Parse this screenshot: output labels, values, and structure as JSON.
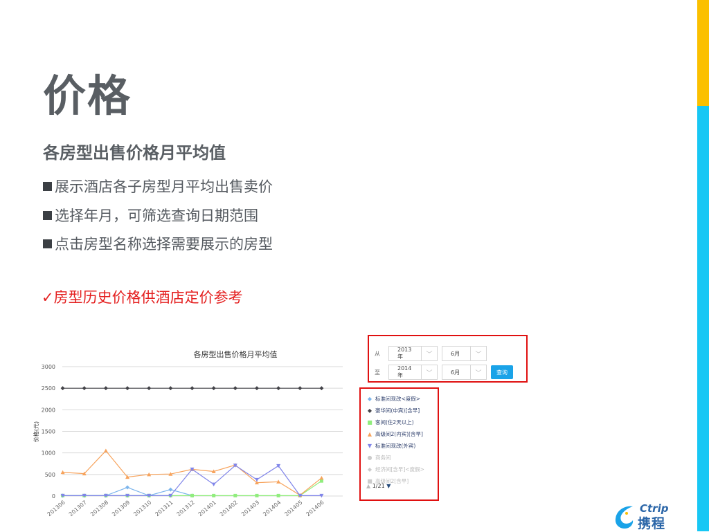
{
  "slide": {
    "title": "价格",
    "subtitle": "各房型出售价格月平均值",
    "bullets": [
      "展示酒店各子房型月平均出售卖价",
      "选择年月，可筛选查询日期范围",
      "点击房型名称选择需要展示的房型"
    ],
    "highlight": "✓房型历史价格供酒店定价参考",
    "accent_colors": {
      "top": "#fbc000",
      "bottom": "#17c7f4",
      "highlight": "#e41f1f"
    }
  },
  "filter": {
    "from_label": "从",
    "to_label": "至",
    "from_year": "2013年",
    "from_month": "6月",
    "to_year": "2014年",
    "to_month": "6月",
    "query_button": "查询",
    "dropdown_icon": "chevron-down-icon"
  },
  "legend": {
    "items": [
      {
        "label": "标准间现改<度假>",
        "marker": "◆",
        "color": "#7cb5ec",
        "active": true
      },
      {
        "label": "豪华间(中宾)[含早]",
        "marker": "◆",
        "color": "#434348",
        "active": true
      },
      {
        "label": "客间(住2天以上)",
        "marker": "■",
        "color": "#90ed7d",
        "active": true
      },
      {
        "label": "高级间2(内宾)[含早]",
        "marker": "▲",
        "color": "#f7a35c",
        "active": true
      },
      {
        "label": "标准间现改(外宾)",
        "marker": "▼",
        "color": "#8085e9",
        "active": true
      },
      {
        "label": "商务间",
        "marker": "●",
        "color": "#cccccc",
        "active": false
      },
      {
        "label": "经济间[含早]<度假>",
        "marker": "◆",
        "color": "#cccccc",
        "active": false
      },
      {
        "label": "高级间2[含早]",
        "marker": "■",
        "color": "#cccccc",
        "active": false
      }
    ],
    "pager": "1/21",
    "pager_up": "▲",
    "pager_down": "▼"
  },
  "logo": {
    "en": "Ctrip",
    "cn": "携程"
  },
  "chart_data": {
    "type": "line",
    "title": "各房型出售价格月平均值",
    "ylabel": "价格(元)",
    "ylim": [
      0,
      3000
    ],
    "yticks": [
      0,
      500,
      1000,
      1500,
      2000,
      2500,
      3000
    ],
    "grid": true,
    "categories": [
      "201306",
      "201307",
      "201308",
      "201309",
      "201310",
      "201311",
      "201312",
      "201401",
      "201402",
      "201403",
      "201404",
      "201405",
      "201406"
    ],
    "series": [
      {
        "name": "标准间现改<度假>",
        "color": "#7cb5ec",
        "marker": "diamond",
        "values": [
          10,
          10,
          10,
          200,
          10,
          150,
          10,
          null,
          null,
          null,
          null,
          null,
          null
        ]
      },
      {
        "name": "豪华间(中宾)[含早]",
        "color": "#434348",
        "marker": "diamond",
        "values": [
          2500,
          2500,
          2500,
          2500,
          2500,
          2500,
          2500,
          2500,
          2500,
          2500,
          2500,
          2500,
          2500
        ]
      },
      {
        "name": "客间(住2天以上)",
        "color": "#90ed7d",
        "marker": "square",
        "values": [
          10,
          10,
          10,
          10,
          10,
          10,
          10,
          10,
          10,
          10,
          10,
          10,
          350
        ]
      },
      {
        "name": "高级间2(内宾)[含早]",
        "color": "#f7a35c",
        "marker": "triangle",
        "values": [
          550,
          520,
          1050,
          440,
          500,
          510,
          620,
          570,
          720,
          310,
          330,
          20,
          420
        ]
      },
      {
        "name": "标准间现改(外宾)",
        "color": "#8085e9",
        "marker": "triangle-down",
        "values": [
          10,
          10,
          10,
          10,
          10,
          10,
          620,
          270,
          710,
          380,
          700,
          10,
          10
        ]
      }
    ]
  }
}
